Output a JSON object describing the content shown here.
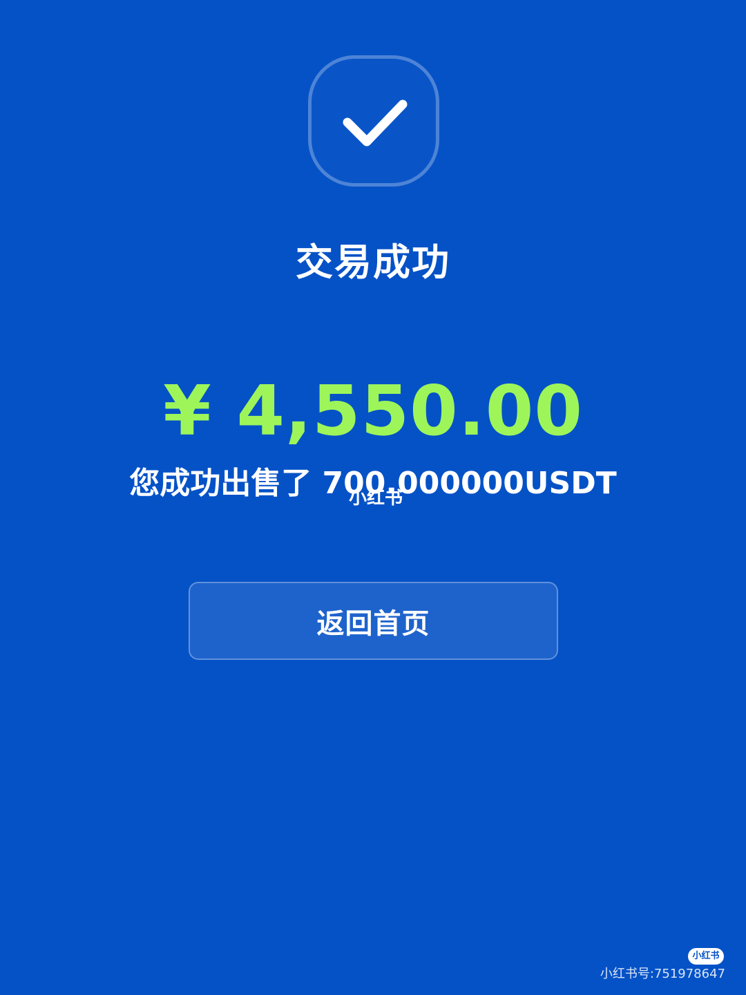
{
  "theme": {
    "background": "#0552C7",
    "amount_color": "#9EF55A",
    "text_color": "#FFFFFF"
  },
  "status": {
    "icon": "check-icon",
    "title": "交易成功"
  },
  "transaction": {
    "amount": "¥ 4,550.00",
    "description": "您成功出售了 700.000000USDT"
  },
  "actions": {
    "home_button_label": "返回首页"
  },
  "watermark": {
    "center_text": "小红书",
    "badge_text": "小红书",
    "account_id": "小红书号:751978647"
  }
}
